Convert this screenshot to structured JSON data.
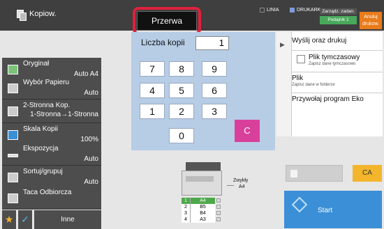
{
  "header": {
    "app_title": "Kopiow.",
    "break_label": "Przerwa",
    "line_label": "LINIA",
    "printer_label": "DRUKARK",
    "tray_status_top": "Zarządz. zadan.",
    "tray_status_bottom": "Podajnik 1",
    "cancel_print": "Anuluj drukow."
  },
  "sidebar": {
    "items": [
      {
        "label": "Oryginał",
        "value": "Auto A4"
      },
      {
        "label": "Wybór Papieru",
        "value": "Auto"
      },
      {
        "label": "2-Stronna Kop.",
        "value": "1-Stronna→1-Stronna"
      },
      {
        "label": "Skala Kopii",
        "value": "100%"
      },
      {
        "label": "Ekspozycja",
        "value": "Auto"
      },
      {
        "label": "Sortuj/grupuj",
        "value": "Auto"
      },
      {
        "label": "Taca Odbiorcza",
        "value": ""
      }
    ],
    "other_label": "Inne"
  },
  "keypad": {
    "copies_label": "Liczba kopii",
    "copies_value": "1",
    "keys": [
      "7",
      "8",
      "9",
      "4",
      "5",
      "6",
      "1",
      "2",
      "3",
      "0"
    ],
    "clear_label": "C"
  },
  "right_panel": {
    "send_print": "Wyślij oraz drukuj",
    "temp_file": "Plik tymczasowy",
    "temp_file_sub": "Zapisz dane tymczasowo",
    "file": "Plik",
    "file_sub": "Zapisz dane w folderze",
    "eco": "Przywołaj program Eko"
  },
  "actions": {
    "ca_label": "CA",
    "start_label": "Start"
  },
  "tray_info": {
    "text1": "Zwykły",
    "text2": "A4",
    "rows": [
      {
        "num": "1",
        "size": "A4"
      },
      {
        "num": "2",
        "size": "B5"
      },
      {
        "num": "3",
        "size": "B4"
      },
      {
        "num": "4",
        "size": "A3"
      }
    ]
  }
}
